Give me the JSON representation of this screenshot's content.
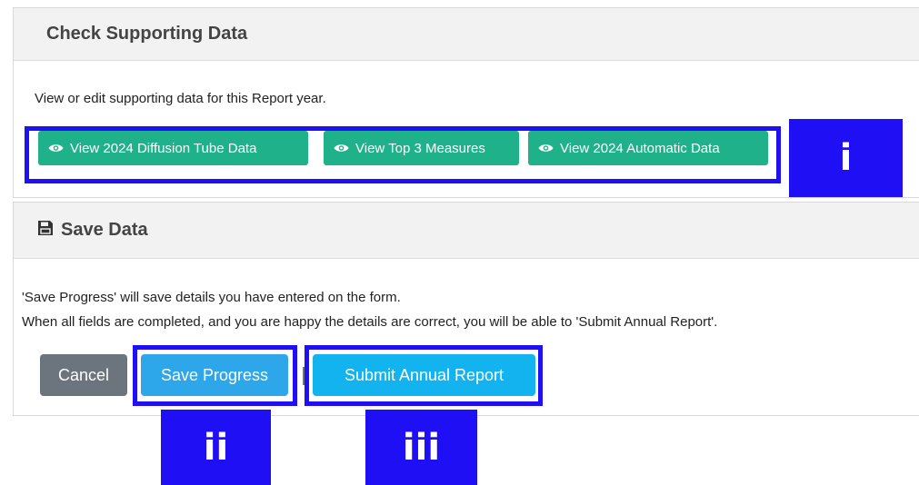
{
  "check_section": {
    "title": "Check Supporting Data",
    "description": "View or edit supporting data for this Report year.",
    "buttons": [
      {
        "label": "View 2024 Diffusion Tube Data",
        "icon": "eye-icon"
      },
      {
        "label": "View Top 3 Measures",
        "icon": "eye-icon"
      },
      {
        "label": "View 2024 Automatic Data",
        "icon": "eye-icon"
      }
    ]
  },
  "save_section": {
    "title": "Save Data",
    "icon": "floppy-disk-icon",
    "line1": "'Save Progress' will save details you have entered on the form.",
    "line2": "When all fields are completed, and you are happy the details are correct, you will be able to 'Submit Annual Report'.",
    "cancel_label": "Cancel",
    "save_label": "Save Progress",
    "submit_label": "Submit Annual Report"
  },
  "callouts": {
    "i": "i",
    "ii": "ii",
    "iii": "iii"
  },
  "colors": {
    "view_button": "#1fb28a",
    "save_button": "#2ea7ea",
    "submit_button": "#12b3ee",
    "cancel_button": "#6c757d",
    "callout": "#1f0ff5"
  }
}
